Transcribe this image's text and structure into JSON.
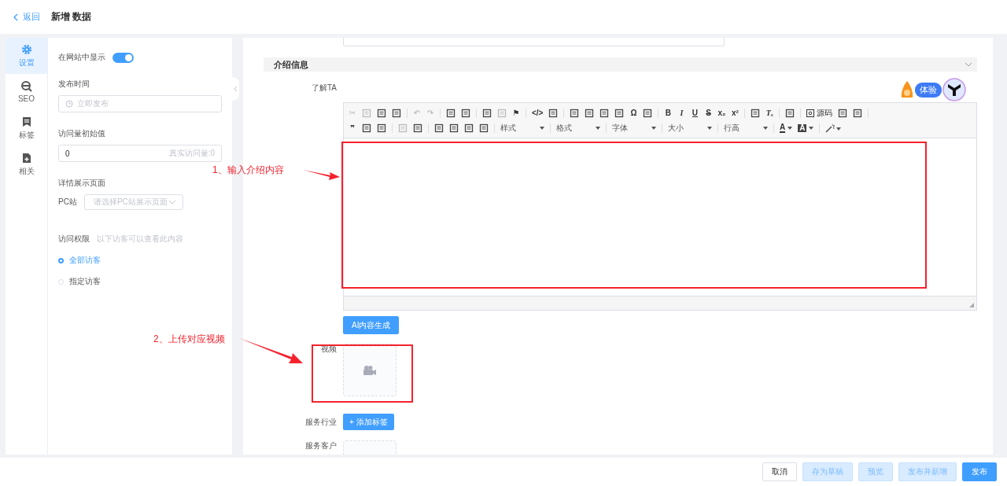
{
  "header": {
    "back": "返回",
    "title": "新增 数据"
  },
  "side_nav": [
    {
      "label": "设置",
      "selected": true
    },
    {
      "label": "SEO",
      "selected": false
    },
    {
      "label": "标签",
      "selected": false
    },
    {
      "label": "相关",
      "selected": false
    }
  ],
  "settings": {
    "show_on_site": {
      "label": "在网站中显示",
      "on": true
    },
    "publish_time": {
      "label": "发布时间",
      "placeholder": "立即发布"
    },
    "initial_views": {
      "label": "访问量初始值",
      "value": "0",
      "hint": "真实访问量:0"
    },
    "detail_page": {
      "label": "详情展示页面",
      "site_label": "PC站",
      "placeholder": "请选择PC站展示页面"
    },
    "access": {
      "label": "访问权限",
      "hint": "以下访客可以查看此内容",
      "options": [
        {
          "label": "全部访客",
          "selected": true
        },
        {
          "label": "指定访客",
          "selected": false
        }
      ]
    }
  },
  "section": {
    "title": "介绍信息",
    "expanded": true
  },
  "about_label": "了解TA",
  "helper_badge": "体验",
  "editor": {
    "toolbar": [
      [
        {
          "kind": "glyph",
          "text": "✂",
          "disabled": true
        },
        {
          "kind": "icon",
          "disabled": true
        },
        {
          "kind": "icon",
          "disabled": false
        },
        {
          "kind": "icon",
          "disabled": false
        },
        {
          "kind": "sep"
        },
        {
          "kind": "glyph",
          "text": "↶",
          "disabled": true
        },
        {
          "kind": "glyph",
          "text": "↷",
          "disabled": true
        },
        {
          "kind": "sep"
        },
        {
          "kind": "icon",
          "disabled": false
        },
        {
          "kind": "icon",
          "disabled": false
        },
        {
          "kind": "sep"
        },
        {
          "kind": "icon",
          "disabled": false
        },
        {
          "kind": "icon",
          "disabled": true
        },
        {
          "kind": "glyph",
          "text": "⚑",
          "disabled": false
        },
        {
          "kind": "sep"
        },
        {
          "kind": "glyph",
          "text": "</>",
          "disabled": false
        },
        {
          "kind": "icon",
          "disabled": false
        },
        {
          "kind": "sep"
        },
        {
          "kind": "icon",
          "disabled": false
        },
        {
          "kind": "icon",
          "disabled": false
        },
        {
          "kind": "icon",
          "disabled": false
        },
        {
          "kind": "icon",
          "disabled": false
        },
        {
          "kind": "glyph",
          "text": "Ω",
          "disabled": false
        },
        {
          "kind": "icon",
          "disabled": false
        },
        {
          "kind": "sep"
        },
        {
          "kind": "bold",
          "text": "B",
          "disabled": false
        },
        {
          "kind": "italic",
          "text": "I",
          "disabled": false
        },
        {
          "kind": "underline",
          "text": "U",
          "disabled": false
        },
        {
          "kind": "strike",
          "text": "S",
          "disabled": false
        },
        {
          "kind": "glyph",
          "text": "x₂",
          "disabled": false
        },
        {
          "kind": "glyph",
          "text": "x²",
          "disabled": false
        },
        {
          "kind": "sep"
        },
        {
          "kind": "icon",
          "disabled": false
        },
        {
          "kind": "italic",
          "text": "Tₓ",
          "disabled": false
        },
        {
          "kind": "sep"
        },
        {
          "kind": "icon",
          "disabled": false
        },
        {
          "kind": "sep"
        },
        {
          "kind": "source",
          "text": "源码"
        },
        {
          "kind": "icon",
          "disabled": false
        },
        {
          "kind": "icon",
          "disabled": false
        },
        {
          "kind": "sep"
        }
      ],
      [
        {
          "kind": "glyph",
          "text": "❞",
          "disabled": false
        },
        {
          "kind": "icon",
          "disabled": false
        },
        {
          "kind": "icon",
          "disabled": false
        },
        {
          "kind": "sep"
        },
        {
          "kind": "icon",
          "disabled": true
        },
        {
          "kind": "icon",
          "disabled": false
        },
        {
          "kind": "sep"
        },
        {
          "kind": "icon",
          "disabled": false
        },
        {
          "kind": "icon",
          "disabled": false
        },
        {
          "kind": "icon",
          "disabled": false
        },
        {
          "kind": "icon",
          "disabled": false
        },
        {
          "kind": "sep"
        },
        {
          "kind": "dropdown",
          "text": "样式"
        },
        {
          "kind": "sep"
        },
        {
          "kind": "dropdown",
          "text": "格式"
        },
        {
          "kind": "sep"
        },
        {
          "kind": "dropdown",
          "text": "字体"
        },
        {
          "kind": "sep"
        },
        {
          "kind": "dropdown",
          "text": "大小"
        },
        {
          "kind": "sep"
        },
        {
          "kind": "dropdown",
          "text": "行高"
        },
        {
          "kind": "sep"
        },
        {
          "kind": "color",
          "text": "A",
          "filled": false
        },
        {
          "kind": "color",
          "text": "A",
          "filled": true
        },
        {
          "kind": "sep"
        },
        {
          "kind": "wand"
        }
      ]
    ]
  },
  "ai_button": "AI内容生成",
  "video_label": "视频",
  "industry": {
    "label": "服务行业",
    "button": "+ 添加标签"
  },
  "clients_label": "服务客户",
  "annotations": [
    {
      "text": "1、输入介绍内容"
    },
    {
      "text": "2、上传对应视频"
    }
  ],
  "footer_buttons": [
    {
      "label": "取消",
      "kind": "default"
    },
    {
      "label": "存为草稿",
      "kind": "light"
    },
    {
      "label": "预览",
      "kind": "light"
    },
    {
      "label": "发布并新增",
      "kind": "light"
    },
    {
      "label": "发布",
      "kind": "primary"
    }
  ]
}
